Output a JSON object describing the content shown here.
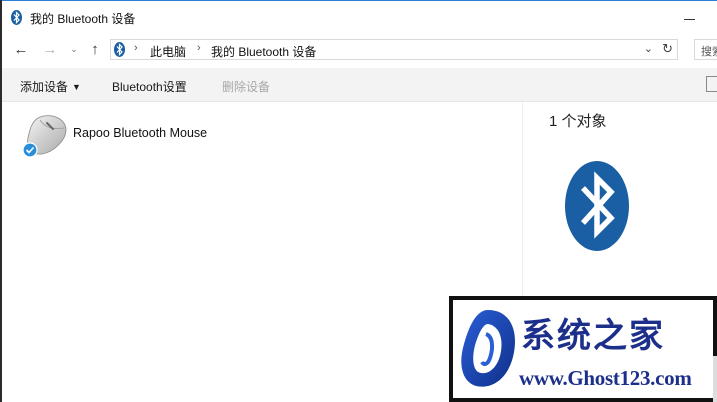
{
  "window": {
    "title": "我的 Bluetooth 设备",
    "accent_color": "#2b7fd6"
  },
  "nav": {
    "back_icon": "arrow-left-icon",
    "forward_icon": "arrow-right-icon",
    "recent_icon": "chevron-down-icon",
    "up_icon": "arrow-up-icon",
    "refresh_icon": "refresh-icon"
  },
  "address": {
    "crumbs": [
      "此电脑",
      "我的 Bluetooth 设备"
    ],
    "separator": "›"
  },
  "search": {
    "placeholder": "搜索"
  },
  "toolbar": {
    "add_device": "添加设备",
    "bluetooth_settings": "Bluetooth设置",
    "remove_device": "删除设备"
  },
  "devices": [
    {
      "label": "Rapoo Bluetooth Mouse",
      "icon": "mouse-icon",
      "status_icon": "check-badge-icon"
    }
  ],
  "details": {
    "count_text": "1 个对象",
    "icon": "bluetooth-icon",
    "icon_color": "#1a5fa3"
  },
  "watermark": {
    "title": "系统之家",
    "url": "www.Ghost123.com",
    "color": "#1c2f8a"
  }
}
